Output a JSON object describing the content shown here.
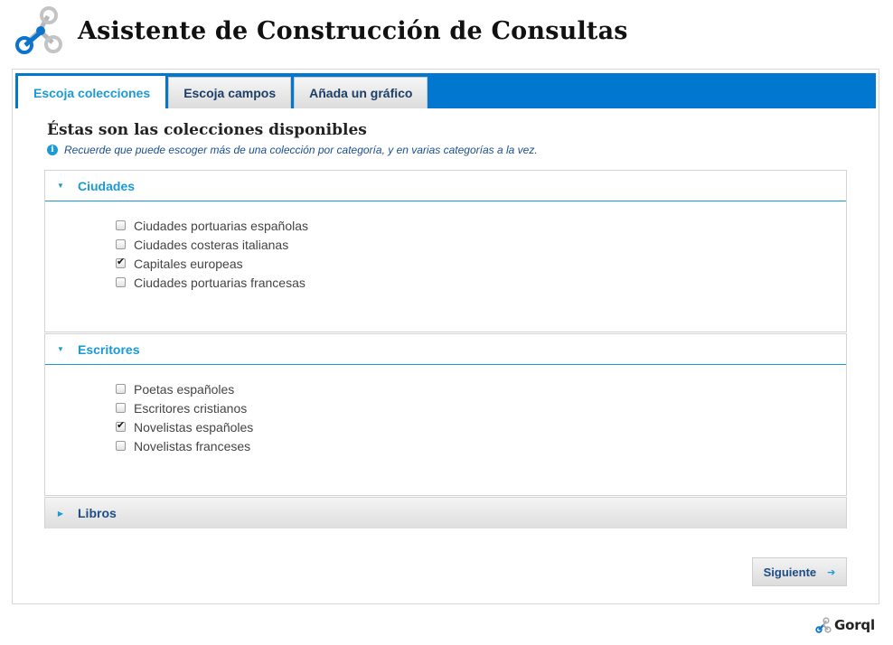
{
  "app": {
    "title": "Asistente de Construcción de Consultas"
  },
  "tabs": [
    {
      "label": "Escoja colecciones",
      "active": true
    },
    {
      "label": "Escoja campos",
      "active": false
    },
    {
      "label": "Añada un gráfico",
      "active": false
    }
  ],
  "content": {
    "heading": "Éstas son las colecciones disponibles",
    "hint": "Recuerde que puede escoger más de una colección por categoría, y en varias categorías a la vez.",
    "hint_icon": "info-icon"
  },
  "categories": [
    {
      "label": "Ciudades",
      "expanded": true,
      "items": [
        {
          "label": "Ciudades portuarias españolas",
          "checked": false
        },
        {
          "label": "Ciudades costeras italianas",
          "checked": false
        },
        {
          "label": "Capitales europeas",
          "checked": true
        },
        {
          "label": "Ciudades portuarias francesas",
          "checked": false
        }
      ]
    },
    {
      "label": "Escritores",
      "expanded": true,
      "items": [
        {
          "label": "Poetas españoles",
          "checked": false
        },
        {
          "label": "Escritores cristianos",
          "checked": false
        },
        {
          "label": "Novelistas españoles",
          "checked": true
        },
        {
          "label": "Novelistas franceses",
          "checked": false
        }
      ]
    },
    {
      "label": "Libros",
      "expanded": false,
      "items": []
    }
  ],
  "actions": {
    "next_label": "Siguiente",
    "next_icon": "arrow-right-icon"
  },
  "footer": {
    "brand": "Gorql"
  },
  "colors": {
    "tabbar": "#0277cf",
    "accent": "#1a9ad6",
    "link_dark": "#1d4c86"
  }
}
